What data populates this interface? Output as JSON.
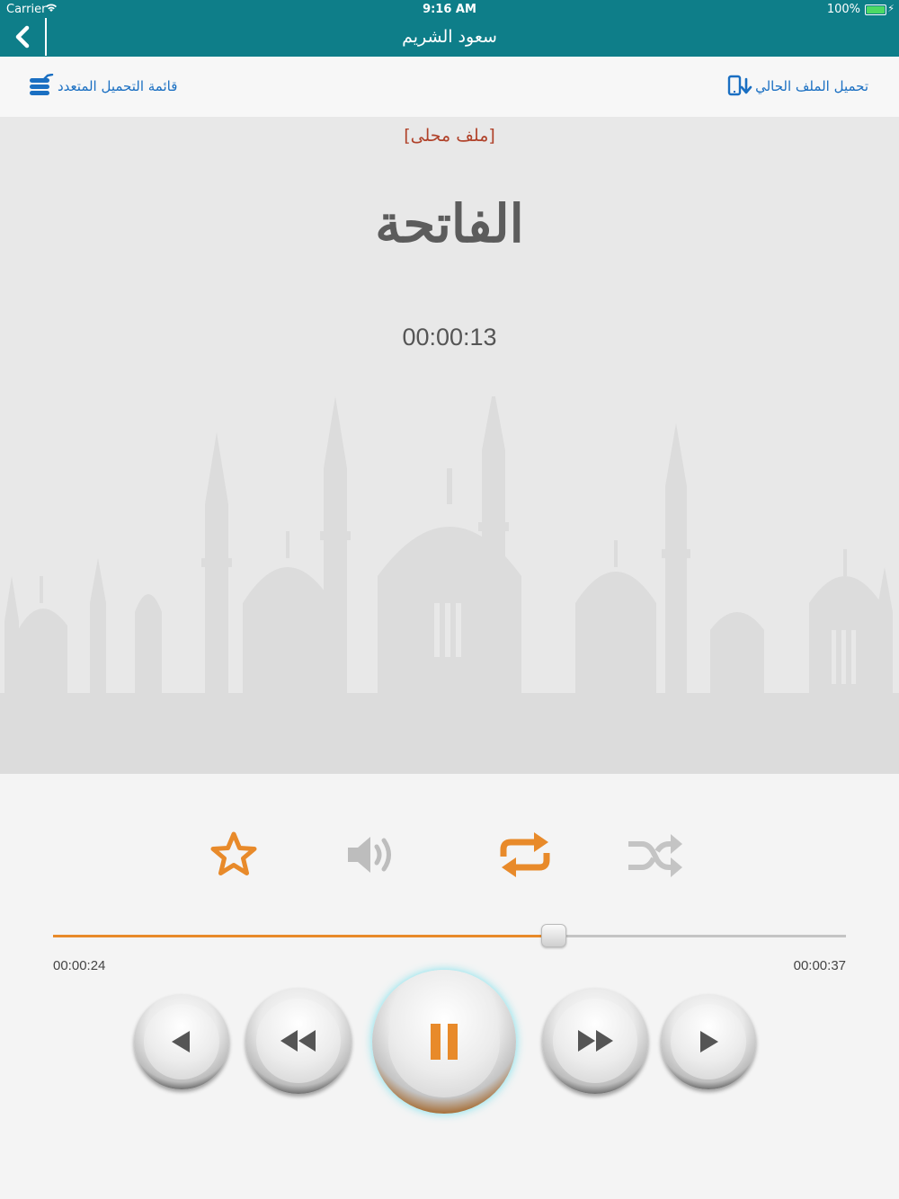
{
  "status_bar": {
    "carrier": "Carrier",
    "time": "9:16 AM",
    "battery": "100%"
  },
  "nav": {
    "title": "سعود الشريم"
  },
  "toolbar": {
    "multi_download_label": "قائمة التحميل المتعدد",
    "download_current_label": "تحميل الملف الحالي"
  },
  "player": {
    "local_tag": "[ملف محلى]",
    "surah_name": "الفاتحة",
    "elapsed": "00:00:13",
    "progress_fraction": 0.63,
    "time_left": "00:00:24",
    "time_right": "00:00:37"
  },
  "colors": {
    "nav_bar": "#0e7e89",
    "link_blue": "#1a6fc2",
    "accent_orange": "#e88a2a",
    "local_tag": "#b0422a",
    "inactive_icon": "#bdbdbd"
  },
  "icons": {
    "favorite": "star-icon",
    "volume": "volume-icon",
    "repeat": "repeat-icon",
    "shuffle": "shuffle-icon",
    "previous": "previous-icon",
    "rewind": "rewind-icon",
    "pause": "pause-icon",
    "fast_forward": "fast-forward-icon",
    "next": "next-icon"
  }
}
